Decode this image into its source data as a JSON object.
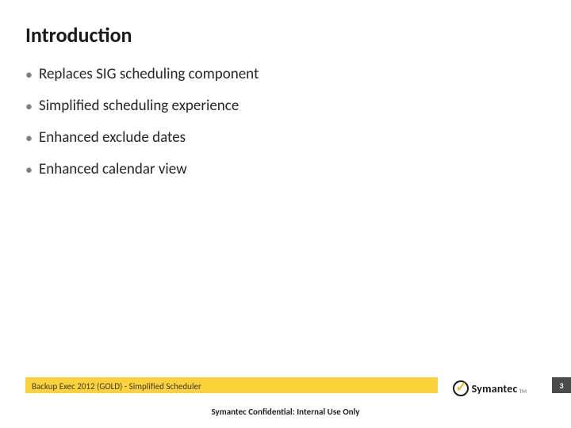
{
  "title": "Introduction",
  "bullets": [
    "Replaces SIG scheduling component",
    "Simplified scheduling experience",
    "Enhanced exclude dates",
    "Enhanced calendar view"
  ],
  "footer": {
    "project": "Backup Exec 2012 (GOLD) - Simplified Scheduler",
    "brand": "Symantec",
    "tm": "TM",
    "page": "3",
    "confidential": "Symantec Confidential:  Internal Use Only"
  }
}
